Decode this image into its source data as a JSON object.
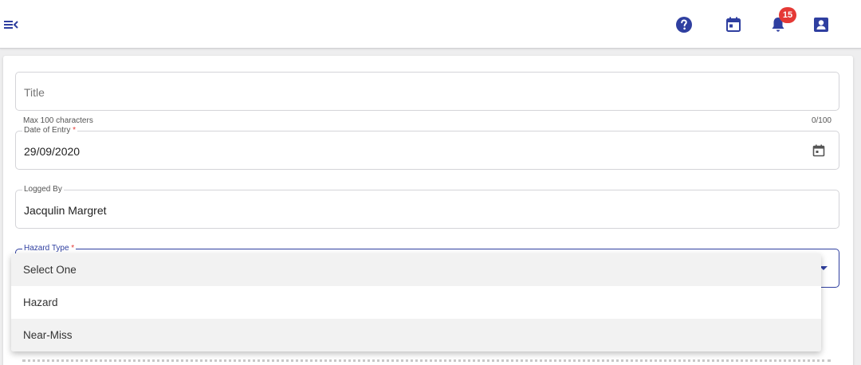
{
  "header": {
    "menu_icon": "menu-collapse-icon",
    "icons": [
      "help-icon",
      "calendar-icon",
      "bell-icon",
      "profile-icon"
    ],
    "notification_count": "15",
    "accent_color": "#2f3fa0",
    "badge_color": "#e53935"
  },
  "form": {
    "title": {
      "placeholder": "Title",
      "hint_left": "Max 100 characters",
      "hint_right": "0/100"
    },
    "date_of_entry": {
      "label": "Date of Entry",
      "required_mark": "*",
      "value": "29/09/2020"
    },
    "logged_by": {
      "label": "Logged By",
      "value": "Jacqulin Margret"
    },
    "hazard_type": {
      "label": "Hazard Type",
      "required_mark": "*",
      "options": [
        "Select One",
        "Hazard",
        "Near-Miss"
      ]
    }
  }
}
